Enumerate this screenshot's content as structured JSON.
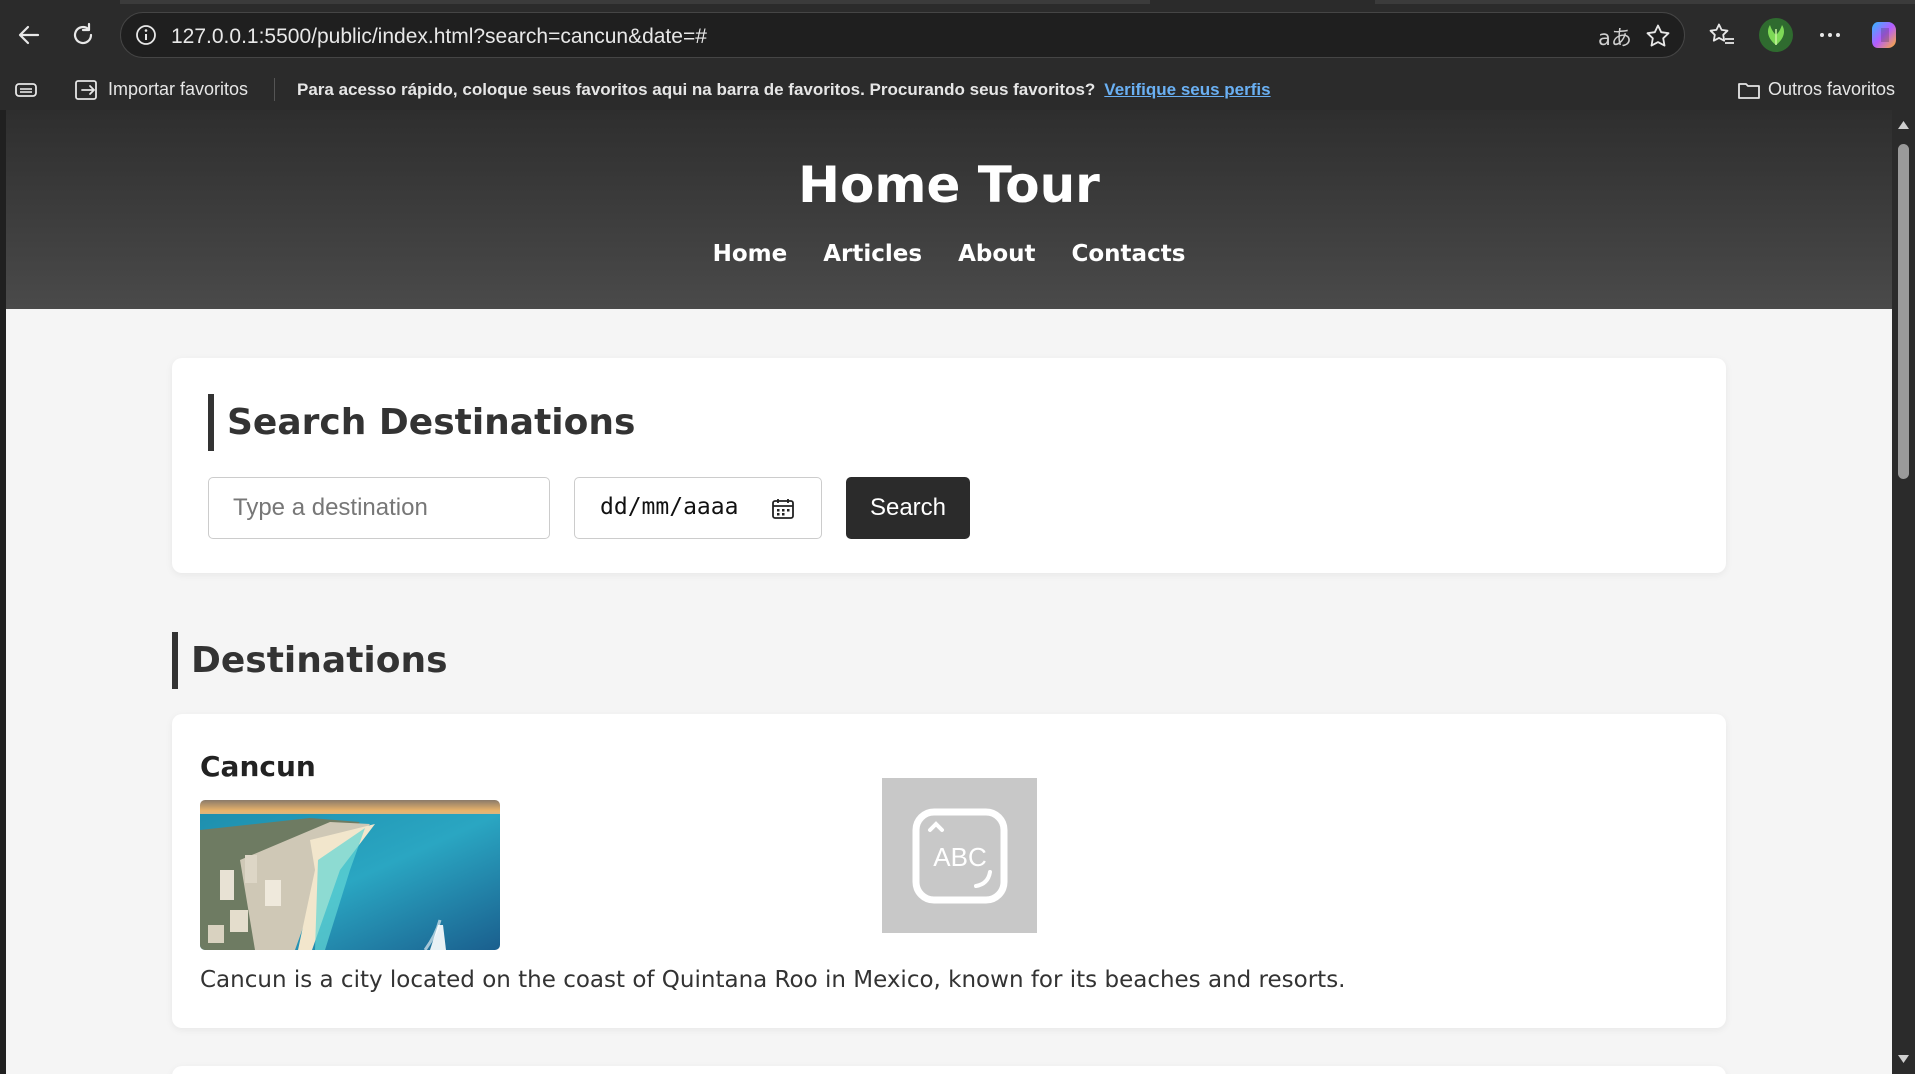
{
  "browser": {
    "url": "127.0.0.1:5500/public/index.html?search=cancun&date=#",
    "icons": [
      "back-icon",
      "refresh-icon",
      "site-info-icon",
      "read-aloud-icon",
      "favorite-star-icon",
      "favorites-icon",
      "profile-icon",
      "more-icon",
      "copilot-icon"
    ]
  },
  "bookmarks_bar": {
    "import_label": "Importar favoritos",
    "message": "Para acesso rápido, coloque seus favoritos aqui na barra de favoritos. Procurando seus favoritos?",
    "link_label": "Verifique seus perfis",
    "other_label": "Outros favoritos"
  },
  "site": {
    "title": "Home Tour",
    "nav": [
      "Home",
      "Articles",
      "About",
      "Contacts"
    ]
  },
  "search": {
    "heading": "Search Destinations",
    "destination_placeholder": "Type a destination",
    "date_placeholder": "dd/mm/aaaa",
    "button_label": "Search"
  },
  "destinations": {
    "heading": "Destinations",
    "items": [
      {
        "name": "Cancun",
        "placeholder_text": "ABC",
        "description": "Cancun is a city located on the coast of Quintana Roo in Mexico, known for its beaches and resorts."
      }
    ]
  },
  "colors": {
    "header_dark": "#2e2e2e",
    "button_dark": "#2b2b2b",
    "link_blue": "#6ab0f3",
    "page_bg": "#f5f5f5"
  }
}
